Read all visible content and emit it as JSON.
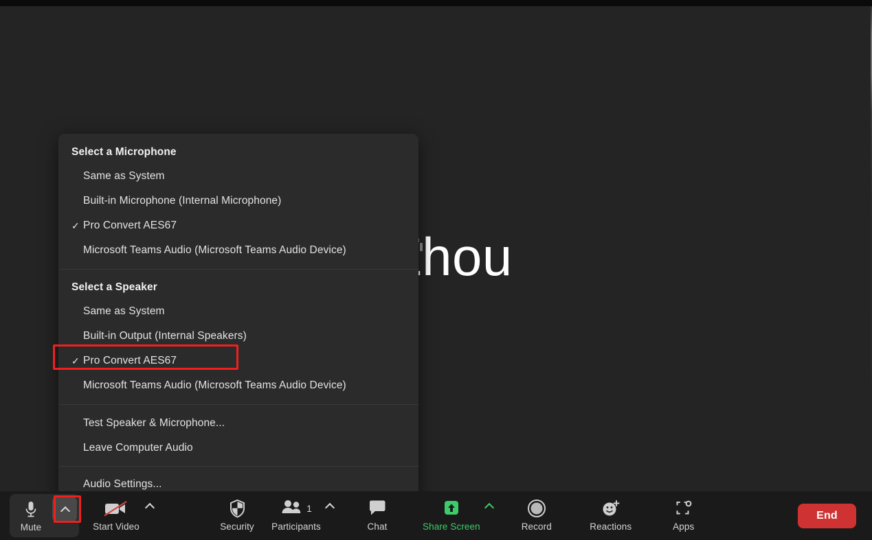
{
  "meeting": {
    "active_speaker_name": "Zhou"
  },
  "audio_menu": {
    "microphone_section": {
      "header": "Select a Microphone",
      "items": [
        {
          "label": "Same as System",
          "checked": false
        },
        {
          "label": "Built-in Microphone (Internal Microphone)",
          "checked": false
        },
        {
          "label": "Pro Convert AES67",
          "checked": true
        },
        {
          "label": "Microsoft Teams Audio (Microsoft Teams Audio Device)",
          "checked": false
        }
      ]
    },
    "speaker_section": {
      "header": "Select a Speaker",
      "items": [
        {
          "label": "Same as System",
          "checked": false
        },
        {
          "label": "Built-in Output (Internal Speakers)",
          "checked": false
        },
        {
          "label": "Pro Convert AES67",
          "checked": true
        },
        {
          "label": "Microsoft Teams Audio (Microsoft Teams Audio Device)",
          "checked": false
        }
      ]
    },
    "actions": [
      {
        "label": "Test Speaker & Microphone..."
      },
      {
        "label": "Leave Computer Audio"
      }
    ],
    "settings": [
      {
        "label": "Audio Settings..."
      }
    ],
    "check_glyph": "✓"
  },
  "toolbar": {
    "mute": {
      "label": "Mute",
      "icon": "microphone-icon",
      "chevron": "chevron-up-icon"
    },
    "video": {
      "label": "Start Video",
      "icon": "video-off-icon",
      "chevron": "chevron-up-icon"
    },
    "security": {
      "label": "Security",
      "icon": "shield-icon"
    },
    "participants": {
      "label": "Participants",
      "icon": "people-icon",
      "count": "1",
      "chevron": "chevron-up-icon"
    },
    "chat": {
      "label": "Chat",
      "icon": "chat-bubble-icon"
    },
    "share_screen": {
      "label": "Share Screen",
      "icon": "share-screen-up-arrow-icon",
      "chevron": "chevron-up-icon"
    },
    "record": {
      "label": "Record",
      "icon": "record-circle-icon"
    },
    "reactions": {
      "label": "Reactions",
      "icon": "smiley-plus-icon"
    },
    "apps": {
      "label": "Apps",
      "icon": "apps-brackets-icon"
    },
    "end": {
      "label": "End"
    }
  },
  "colors": {
    "share_screen_green": "#3ecb6a",
    "end_red": "#cf3232",
    "annotation_red": "#f21f1f",
    "menu_background": "#2b2b2b",
    "toolbar_background": "#1a1a1a",
    "stage_background": "#242424"
  }
}
